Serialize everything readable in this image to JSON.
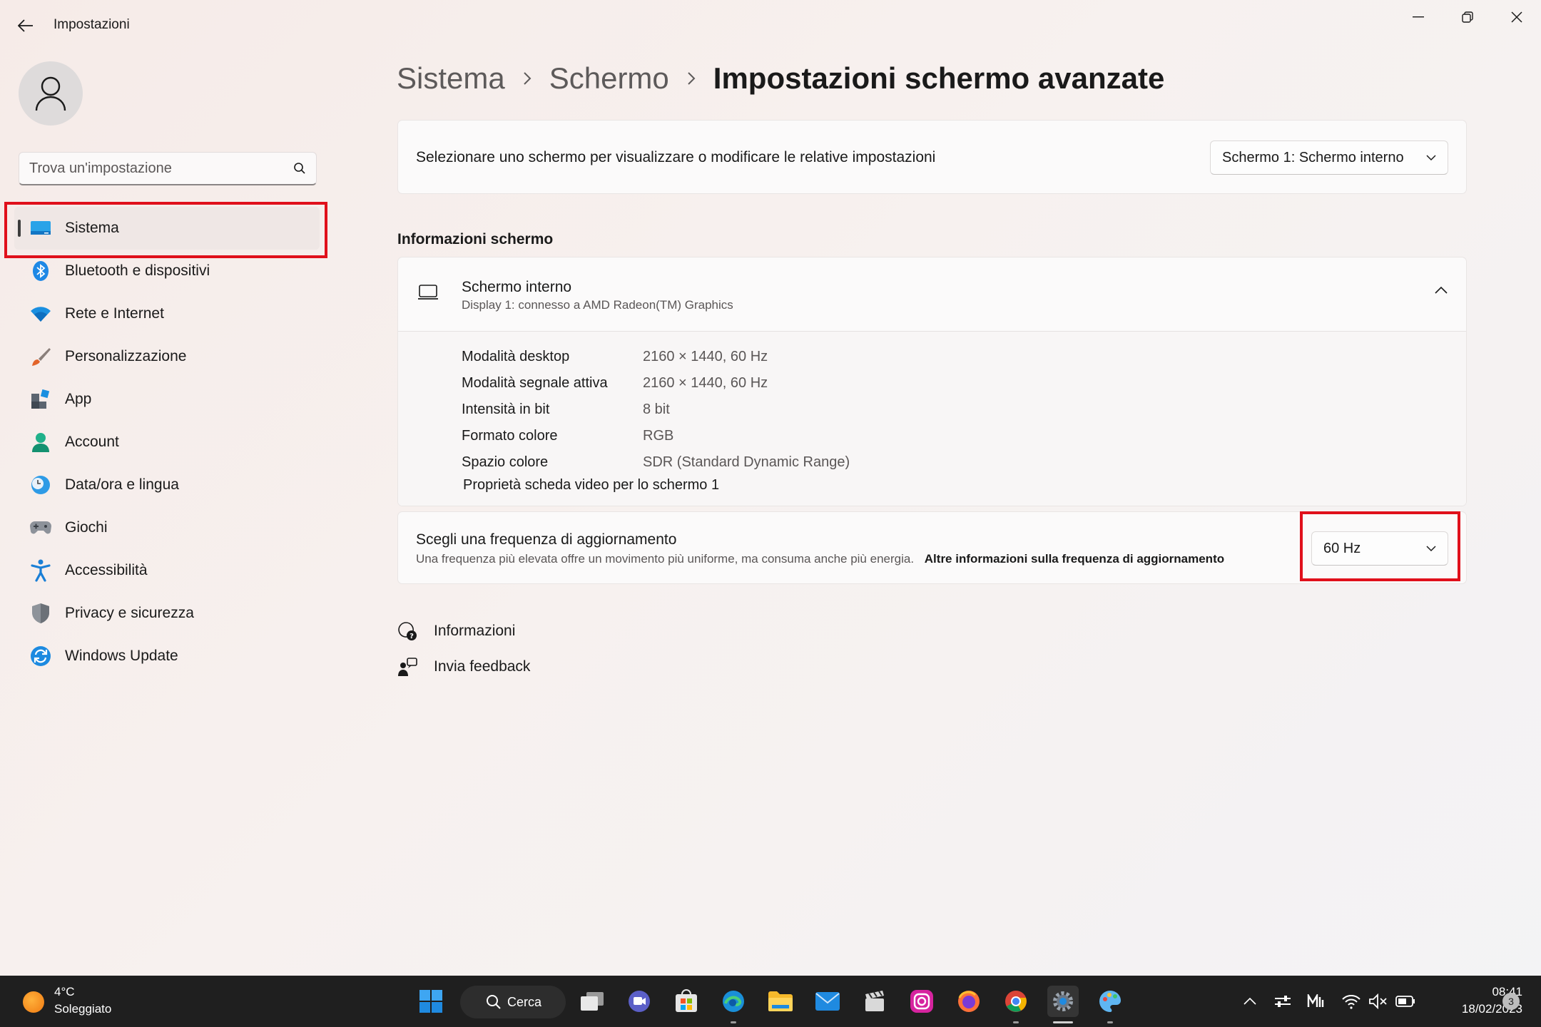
{
  "window": {
    "title": "Impostazioni"
  },
  "sidebar": {
    "search_placeholder": "Trova un'impostazione",
    "items": [
      {
        "label": "Sistema",
        "icon": "system-icon"
      },
      {
        "label": "Bluetooth e dispositivi",
        "icon": "bluetooth-icon"
      },
      {
        "label": "Rete e Internet",
        "icon": "wifi-icon"
      },
      {
        "label": "Personalizzazione",
        "icon": "brush-icon"
      },
      {
        "label": "App",
        "icon": "apps-icon"
      },
      {
        "label": "Account",
        "icon": "account-icon"
      },
      {
        "label": "Data/ora e lingua",
        "icon": "clock-globe-icon"
      },
      {
        "label": "Giochi",
        "icon": "gamepad-icon"
      },
      {
        "label": "Accessibilità",
        "icon": "accessibility-icon"
      },
      {
        "label": "Privacy e sicurezza",
        "icon": "shield-icon"
      },
      {
        "label": "Windows Update",
        "icon": "update-icon"
      }
    ]
  },
  "breadcrumb": {
    "items": [
      "Sistema",
      "Schermo"
    ],
    "current": "Impostazioni schermo avanzate"
  },
  "display_select": {
    "label": "Selezionare uno schermo per visualizzare o modificare le relative impostazioni",
    "value": "Schermo 1: Schermo interno"
  },
  "display_info": {
    "section_title": "Informazioni schermo",
    "title": "Schermo interno",
    "subtitle": "Display 1: connesso a AMD Radeon(TM) Graphics",
    "rows": [
      {
        "key": "Modalità desktop",
        "value": "2160 × 1440, 60 Hz"
      },
      {
        "key": "Modalità segnale attiva",
        "value": "2160 × 1440, 60 Hz"
      },
      {
        "key": "Intensità in bit",
        "value": "8 bit"
      },
      {
        "key": "Formato colore",
        "value": "RGB"
      },
      {
        "key": "Spazio colore",
        "value": "SDR (Standard Dynamic Range)"
      }
    ],
    "adapter_link": "Proprietà scheda video per lo schermo 1"
  },
  "refresh": {
    "title": "Scegli una frequenza di aggiornamento",
    "description": "Una frequenza più elevata offre un movimento più uniforme, ma consuma anche più energia.",
    "more_link": "Altre informazioni sulla frequenza di aggiornamento",
    "value": "60 Hz"
  },
  "help": {
    "info": "Informazioni",
    "feedback": "Invia feedback"
  },
  "taskbar": {
    "weather_temp": "4°C",
    "weather_desc": "Soleggiato",
    "search_label": "Cerca",
    "time": "08:41",
    "date": "18/02/2023",
    "notifications": "3"
  },
  "colors": {
    "accent": "#0067c0",
    "highlight": "#e0101b",
    "taskbar": "#1f1f1f"
  }
}
